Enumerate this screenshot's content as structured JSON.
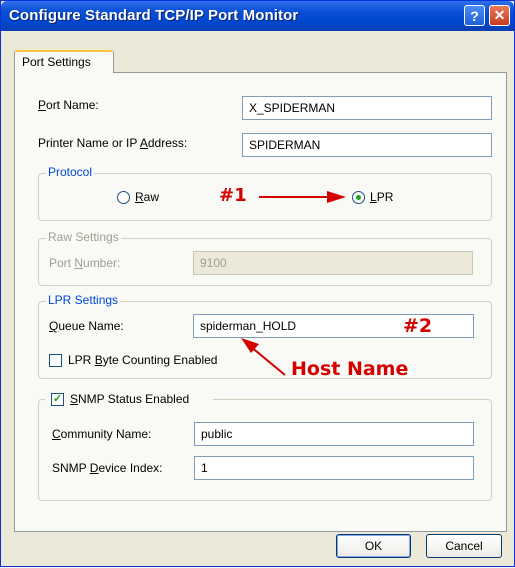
{
  "window": {
    "title": "Configure Standard TCP/IP Port Monitor",
    "help_glyph": "?",
    "close_glyph": "✕"
  },
  "tab": {
    "label": "Port Settings"
  },
  "port_name": {
    "label_u": "P",
    "label_rest": "ort Name:",
    "value": "X_SPIDERMAN"
  },
  "printer_name": {
    "label_pre": "Printer Name or IP ",
    "label_u": "A",
    "label_rest": "ddress:",
    "value": "SPIDERMAN"
  },
  "protocol": {
    "legend": "Protocol",
    "raw": {
      "label_u": "R",
      "label_rest": "aw",
      "selected": false
    },
    "lpr": {
      "label_u": "L",
      "label_rest": "PR",
      "selected": true
    }
  },
  "raw_settings": {
    "legend": "Raw Settings",
    "port_label_pre": "Port ",
    "port_label_u": "N",
    "port_label_rest": "umber:",
    "port_value": "9100"
  },
  "lpr_settings": {
    "legend": "LPR Settings",
    "queue_label_u": "Q",
    "queue_label_rest": "ueue Name:",
    "queue_value": "spiderman_HOLD",
    "byte_counting_pre": "LPR ",
    "byte_counting_u": "B",
    "byte_counting_rest": "yte Counting Enabled",
    "byte_counting_checked": false
  },
  "snmp": {
    "legend_u": "S",
    "legend_rest": "NMP Status Enabled",
    "checked": true,
    "check_glyph": "✓",
    "community_label_u": "C",
    "community_label_rest": "ommunity Name:",
    "community_value": "public",
    "index_label_pre": "SNMP ",
    "index_label_u": "D",
    "index_label_rest": "evice Index:",
    "index_value": "1"
  },
  "buttons": {
    "ok": "OK",
    "cancel": "Cancel"
  },
  "annotations": {
    "marker1": "#1",
    "marker2": "#2",
    "host_name": "Host Name",
    "color": "#d40000"
  }
}
